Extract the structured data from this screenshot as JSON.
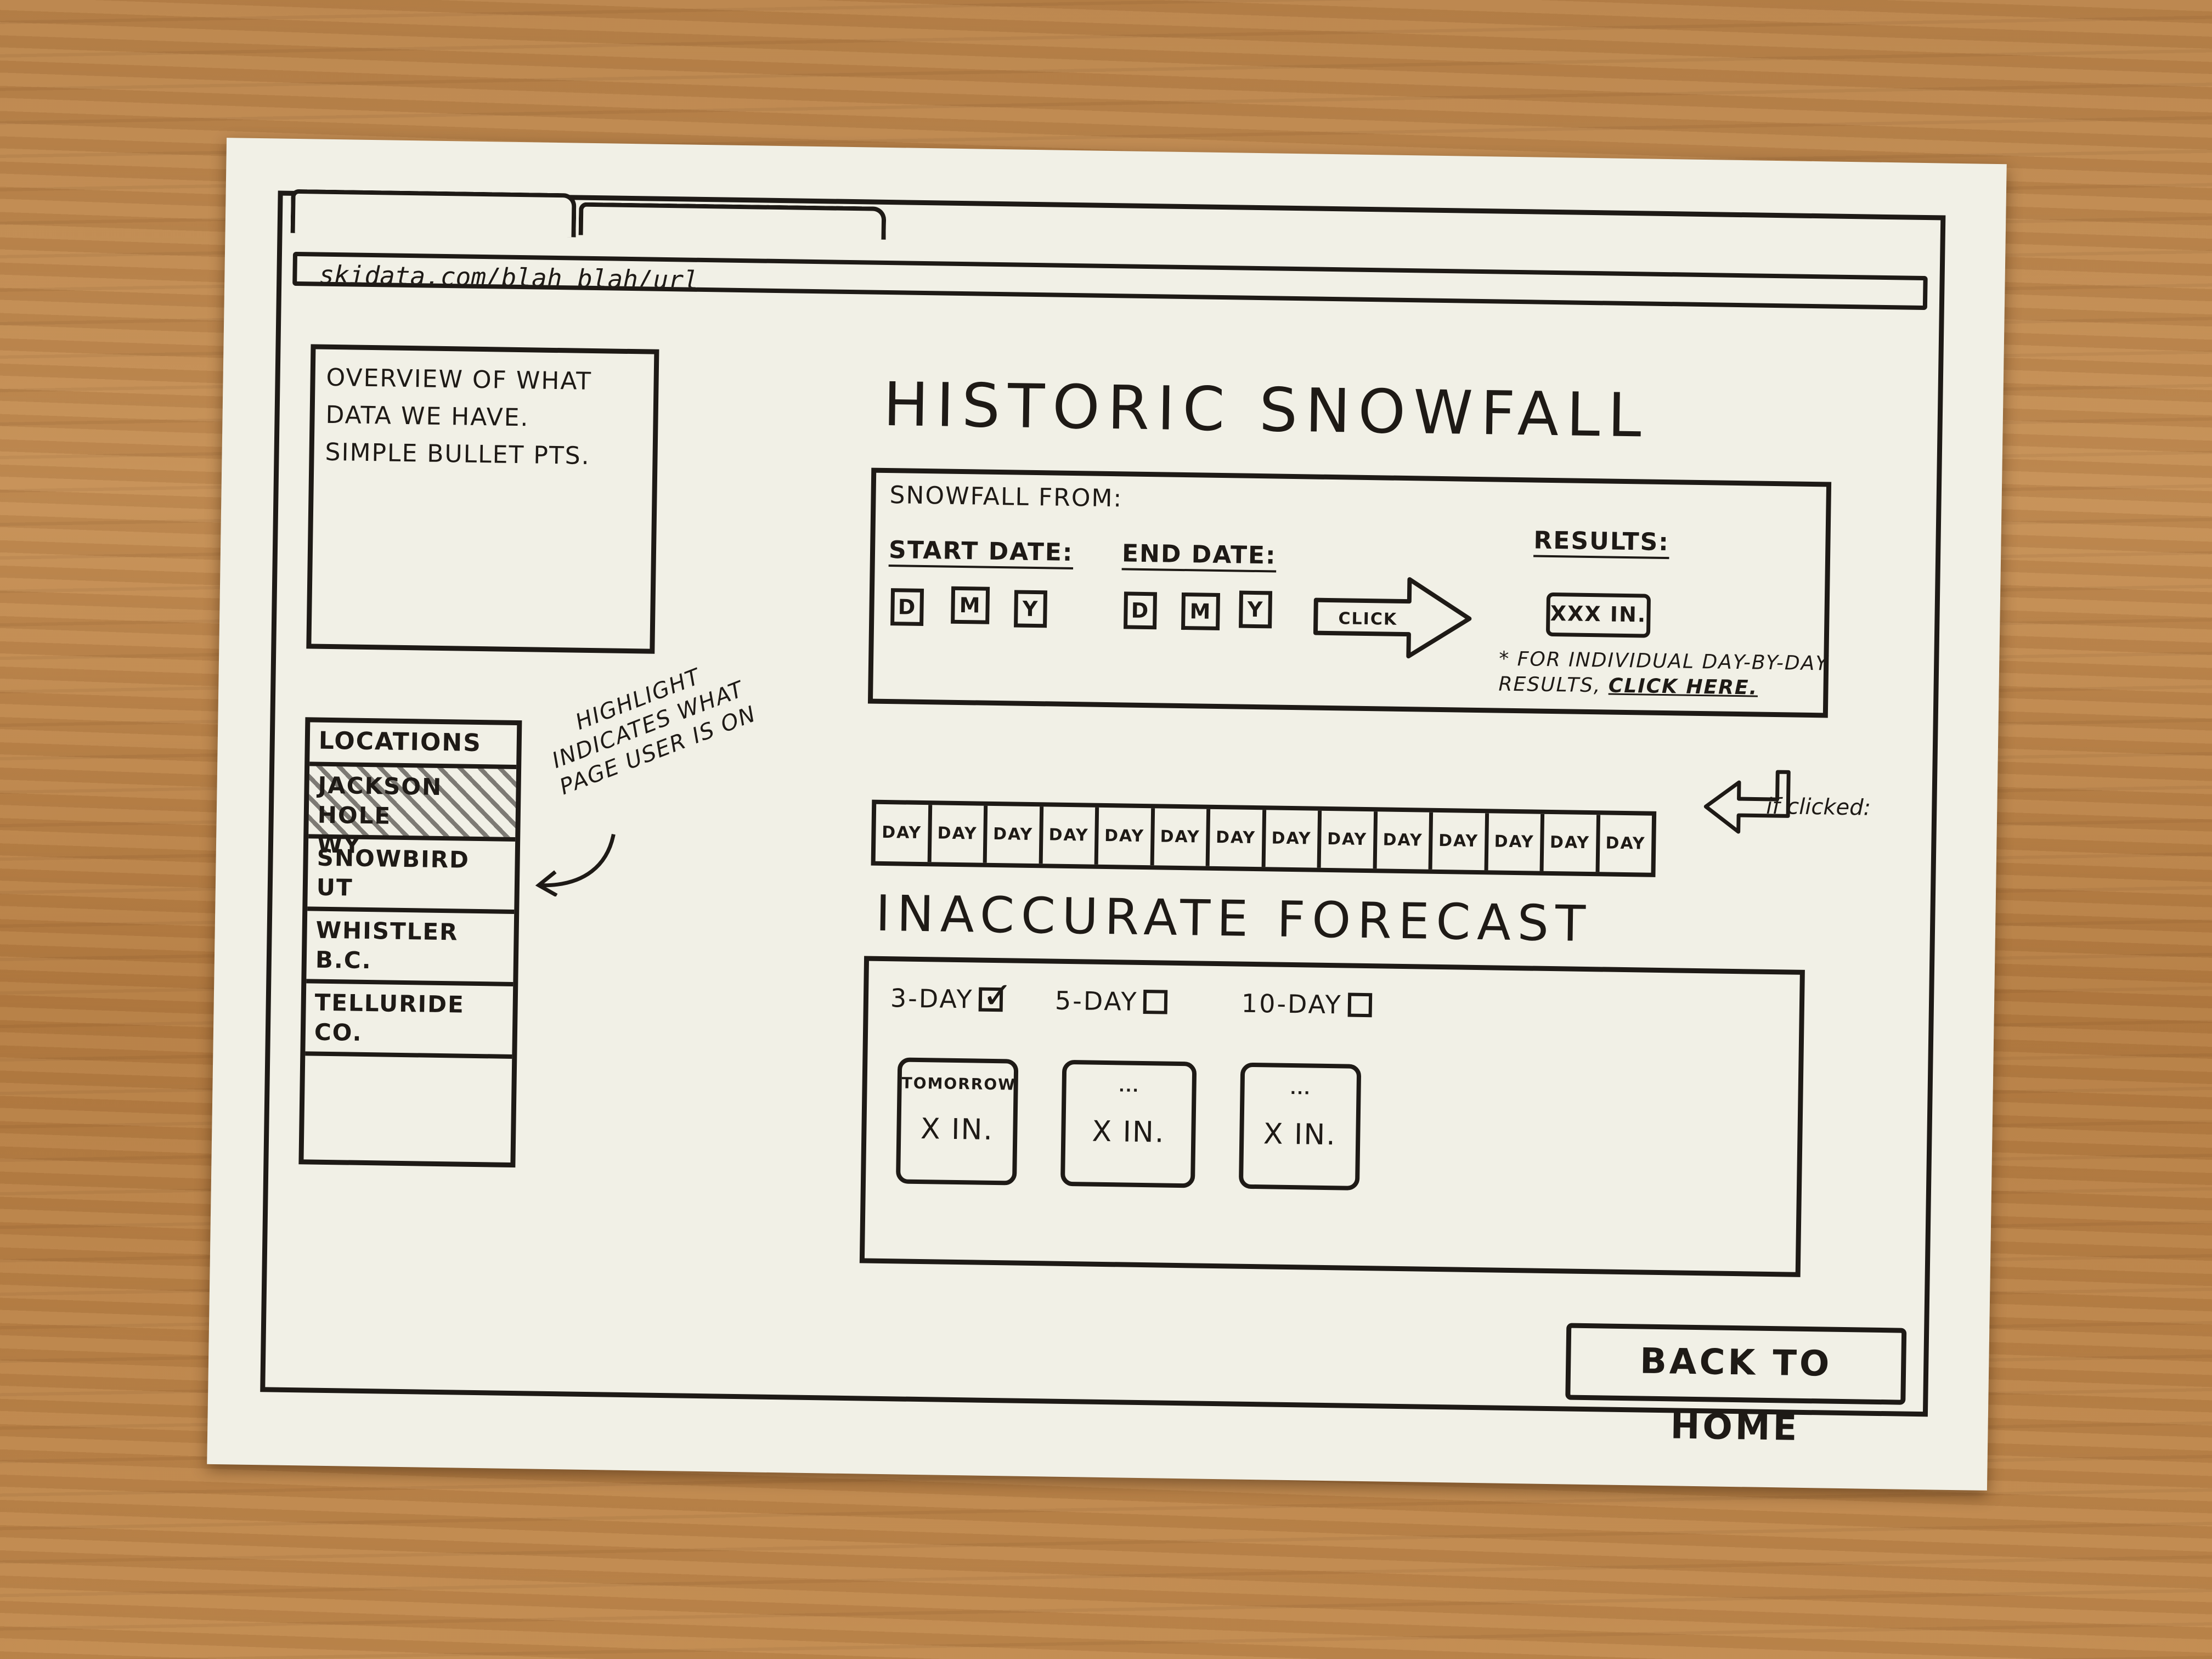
{
  "browser": {
    "url": "skidata.com/blah blah/url"
  },
  "overview": {
    "lines": [
      "OVERVIEW OF WHAT",
      "DATA WE HAVE.",
      "SIMPLE BULLET PTS."
    ]
  },
  "locations": {
    "heading": "LOCATIONS",
    "items": [
      {
        "name": "JACKSON HOLE",
        "region": "WY"
      },
      {
        "name": "SNOWBIRD",
        "region": "UT"
      },
      {
        "name": "WHISTLER",
        "region": "B.C."
      },
      {
        "name": "TELLURIDE",
        "region": "CO."
      }
    ],
    "annotation": "HIGHLIGHT INDICATES WHAT PAGE USER IS ON"
  },
  "historic": {
    "title": "HISTORIC SNOWFALL",
    "from_label": "SNOWFALL FROM:",
    "start_label": "START DATE:",
    "end_label": "END DATE:",
    "start_fields": [
      "D",
      "M",
      "Y"
    ],
    "end_fields": [
      "D",
      "M",
      "Y"
    ],
    "click_label": "CLICK",
    "results_label": "RESULTS:",
    "result_value": "XXX in.",
    "note_prefix": "* for individual day-by-day results,",
    "note_link": "click here.",
    "if_clicked": "if clicked:",
    "days": [
      "DAY",
      "DAY",
      "DAY",
      "DAY",
      "DAY",
      "DAY",
      "DAY",
      "DAY",
      "DAY",
      "DAY",
      "DAY",
      "DAY",
      "DAY",
      "DAY"
    ]
  },
  "forecast": {
    "title": "INACCURATE FORECAST",
    "options": [
      {
        "label": "3-DAY",
        "checked": true
      },
      {
        "label": "5-DAY",
        "checked": false
      },
      {
        "label": "10-DAY",
        "checked": false
      }
    ],
    "cards": [
      {
        "day": "TOMORROW",
        "value": "X in."
      },
      {
        "day": "...",
        "value": "X in."
      },
      {
        "day": "...",
        "value": "X in."
      }
    ]
  },
  "footer": {
    "home_button": "BACK TO HOME"
  }
}
